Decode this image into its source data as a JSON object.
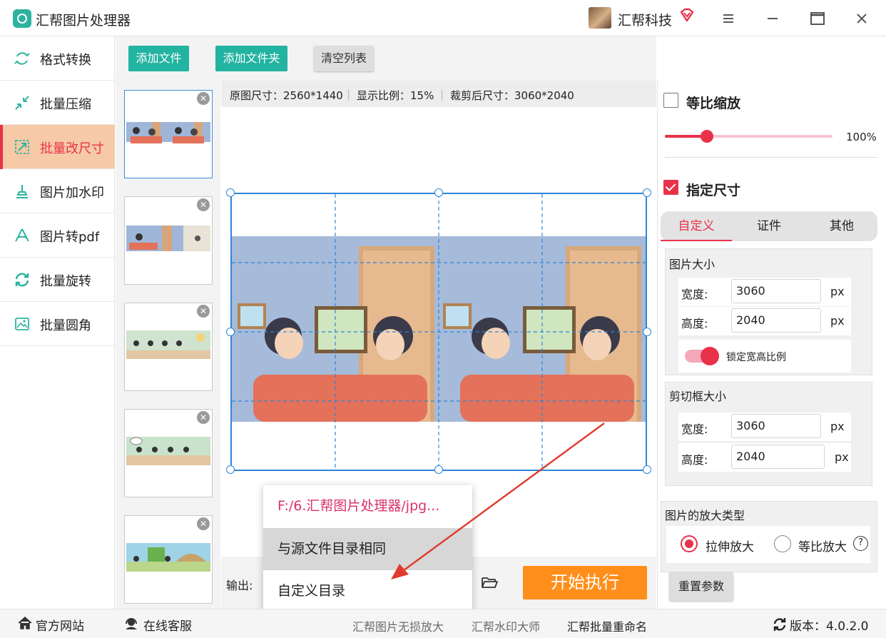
{
  "app": {
    "title": "汇帮图片处理器"
  },
  "user": {
    "name": "汇帮科技"
  },
  "window": {
    "menu_icon": "hamburger-icon",
    "minimize_icon": "minimize-icon",
    "maximize_icon": "maximize-icon",
    "close_icon": "close-icon"
  },
  "sidebar": {
    "items": [
      {
        "label": "格式转换",
        "icon": "convert-icon",
        "active": false
      },
      {
        "label": "批量压缩",
        "icon": "compress-icon",
        "active": false
      },
      {
        "label": "批量改尺寸",
        "icon": "resize-icon",
        "active": true
      },
      {
        "label": "图片加水印",
        "icon": "stamp-icon",
        "active": false
      },
      {
        "label": "图片转pdf",
        "icon": "pdf-icon",
        "active": false
      },
      {
        "label": "批量旋转",
        "icon": "rotate-icon",
        "active": false
      },
      {
        "label": "批量圆角",
        "icon": "image-icon",
        "active": false
      }
    ]
  },
  "toolbar": {
    "add_file": "添加文件",
    "add_folder": "添加文件夹",
    "clear_list": "清空列表"
  },
  "info": {
    "original_size": "原图尺寸：2560*1440",
    "display_ratio": "显示比例：15%",
    "cropped_size": "裁剪后尺寸：3060*2040"
  },
  "output": {
    "label": "输出:",
    "dropdown": {
      "path": "F:/6.汇帮图片处理器/jpg...",
      "same_as_source": "与源文件目录相同",
      "custom": "自定义目录"
    },
    "start_button": "开始执行"
  },
  "panel": {
    "keep_ratio": {
      "label": "等比缩放",
      "checked": false,
      "scale_value": "100%",
      "scale_fraction": 0.25
    },
    "specify_size": {
      "label": "指定尺寸",
      "checked": true
    },
    "tabs": [
      {
        "label": "自定义",
        "active": true
      },
      {
        "label": "证件",
        "active": false
      },
      {
        "label": "其他",
        "active": false
      }
    ],
    "image_size": {
      "title": "图片大小",
      "width_label": "宽度:",
      "width_value": "3060",
      "height_label": "高度:",
      "height_value": "2040",
      "unit": "px",
      "lock_label": "锁定宽高比例",
      "lock_on": true
    },
    "crop_size": {
      "title": "剪切框大小",
      "width_label": "宽度:",
      "width_value": "3060",
      "height_label": "高度:",
      "height_value": "2040",
      "unit": "px"
    },
    "enlarge_type": {
      "title": "图片的放大类型",
      "options": [
        {
          "label": "拉伸放大",
          "selected": true
        },
        {
          "label": "等比放大",
          "selected": false
        }
      ],
      "help": "?"
    },
    "reset_button": "重置参数"
  },
  "statusbar": {
    "website": "官方网站",
    "support": "在线客服",
    "links": [
      "汇帮图片无损放大",
      "汇帮水印大师",
      "汇帮批量重命名"
    ],
    "version": "版本：4.0.2.0"
  },
  "colors": {
    "accent": "#e8324a",
    "teal": "#22b3a1",
    "start": "#ff8e1a",
    "frame": "#2f86d8"
  }
}
